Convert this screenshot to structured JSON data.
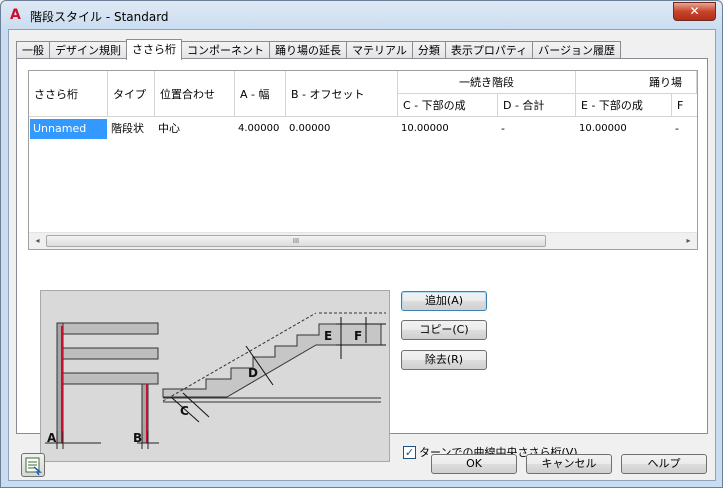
{
  "window": {
    "title": "階段スタイル - Standard",
    "app_icon": "A",
    "close_label": "✕"
  },
  "tabs": [
    {
      "label": "一般"
    },
    {
      "label": "デザイン規則"
    },
    {
      "label": "ささら桁",
      "active": true
    },
    {
      "label": "コンポーネント"
    },
    {
      "label": "踊り場の延長"
    },
    {
      "label": "マテリアル"
    },
    {
      "label": "分類"
    },
    {
      "label": "表示プロパティ"
    },
    {
      "label": "バージョン履歴"
    }
  ],
  "grid": {
    "headers": {
      "stringer": "ささら桁",
      "type": "タイプ",
      "alignment": "位置合わせ",
      "a_width": "A - 幅",
      "b_offset": "B - オフセット",
      "group_continuous": "一続き階段",
      "group_landing": "踊り場",
      "c_bottom": "C - 下部の成",
      "d_total": "D - 合計",
      "e_bottom": "E - 下部の成",
      "f_partial": "F"
    },
    "rows": [
      {
        "stringer": "Unnamed",
        "type": "階段状",
        "alignment": "中心",
        "a_width": "4.00000",
        "b_offset": "0.00000",
        "c_bottom": "10.00000",
        "d_total": "-",
        "e_bottom": "10.00000",
        "f_partial": "-"
      }
    ],
    "scroll_left": "◂",
    "scroll_right": "▸",
    "scroll_grip": "III"
  },
  "diagram_labels": {
    "a": "A",
    "b": "B",
    "c": "C",
    "d": "D",
    "e": "E",
    "f": "F"
  },
  "buttons": {
    "add": "追加(A)",
    "copy": "コピー(C)",
    "remove": "除去(R)",
    "ok": "OK",
    "cancel": "キャンセル",
    "help": "ヘルプ"
  },
  "checkbox": {
    "label": "ターンでの曲線中央ささら桁(V)",
    "checked": true,
    "mark": "✓"
  }
}
